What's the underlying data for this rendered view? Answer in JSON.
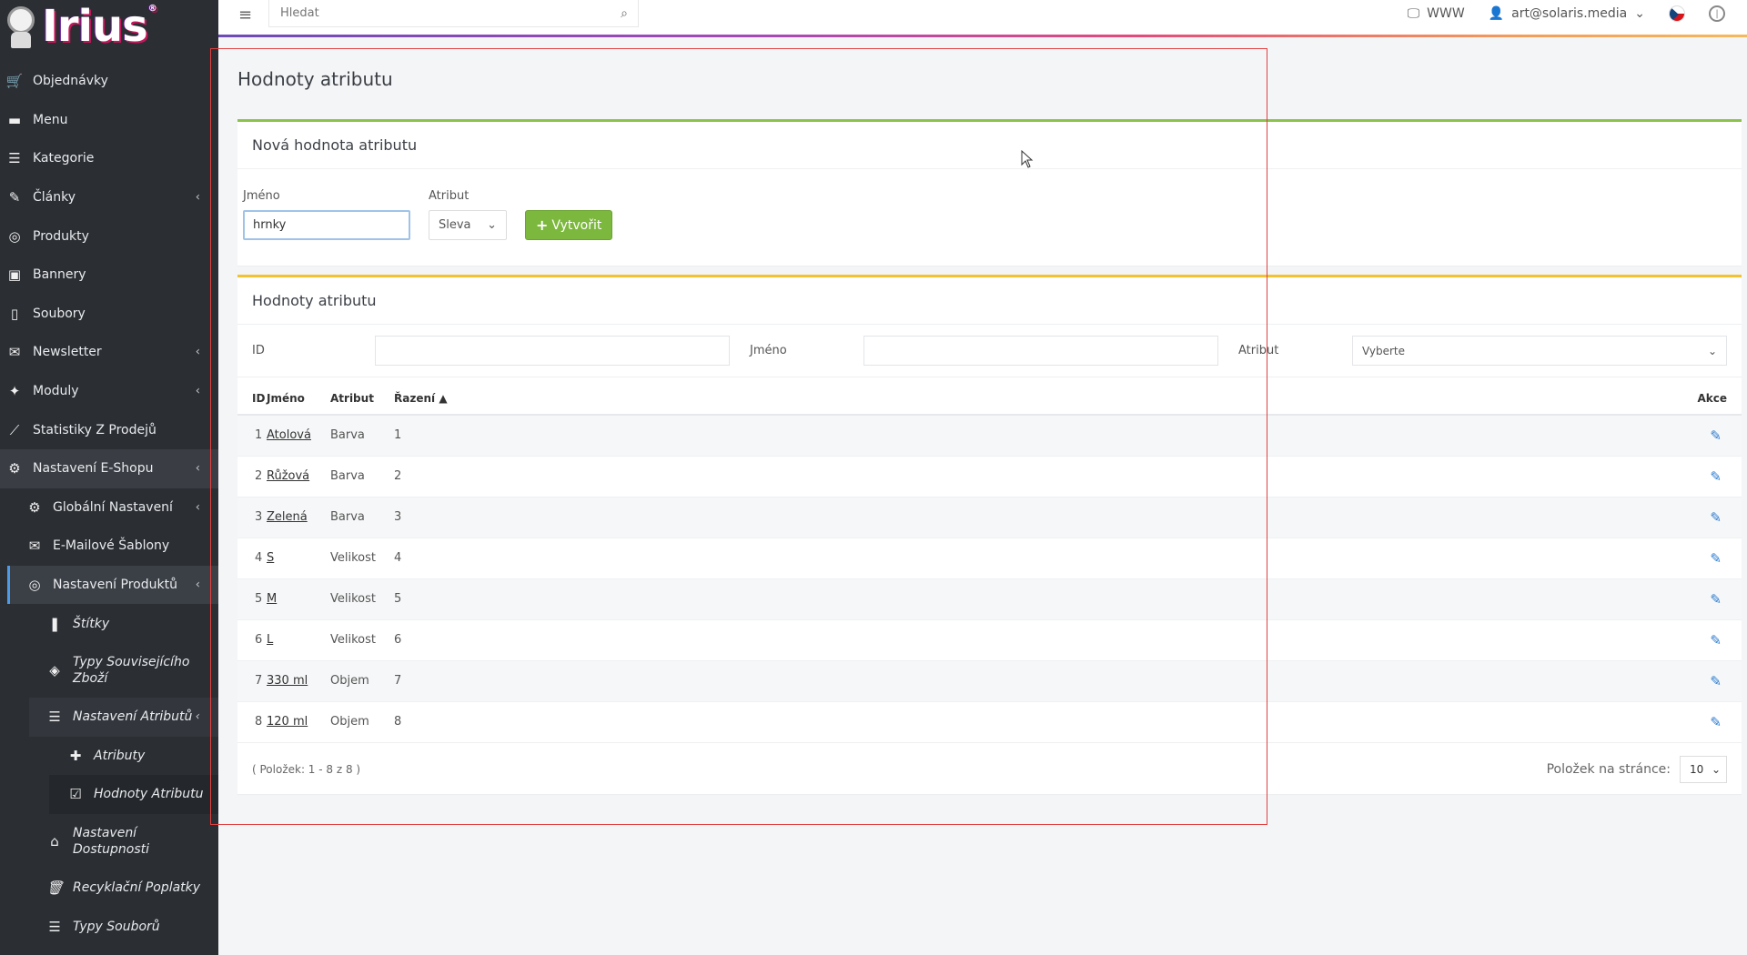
{
  "brand": {
    "logo_text": "Irius",
    "reg": "®"
  },
  "sidebar": {
    "items": [
      {
        "label": "Objednávky",
        "icon": "cart-icon",
        "glyph": "🛒"
      },
      {
        "label": "Menu",
        "icon": "folder-icon",
        "glyph": "▬"
      },
      {
        "label": "Kategorie",
        "icon": "list-icon",
        "glyph": "☰"
      },
      {
        "label": "Články",
        "icon": "pencil-icon",
        "glyph": "✎"
      },
      {
        "label": "Produkty",
        "icon": "globe-icon",
        "glyph": "◎"
      },
      {
        "label": "Bannery",
        "icon": "image-icon",
        "glyph": "▣"
      },
      {
        "label": "Soubory",
        "icon": "file-icon",
        "glyph": "▯"
      },
      {
        "label": "Newsletter",
        "icon": "mail-circle-icon",
        "glyph": "✉"
      },
      {
        "label": "Moduly",
        "icon": "puzzle-icon",
        "glyph": "✦"
      },
      {
        "label": "Statistiky Z Prodejů",
        "icon": "chart-icon",
        "glyph": "⟋"
      },
      {
        "label": "Nastavení E-Shopu",
        "icon": "cogs-icon",
        "glyph": "⚙"
      },
      {
        "label": "Globální Nastavení",
        "icon": "gear-icon",
        "glyph": "⚙"
      },
      {
        "label": "E-Mailové Šablony",
        "icon": "envelope-icon",
        "glyph": "✉"
      },
      {
        "label": "Nastavení Produktů",
        "icon": "globe-icon",
        "glyph": "◎"
      },
      {
        "label": "Štítky",
        "icon": "bookmark-icon",
        "glyph": "❚"
      },
      {
        "label": "Typy Souvisejícího Zboží",
        "icon": "layers-icon",
        "glyph": "◈"
      },
      {
        "label": "Nastavení Atributů",
        "icon": "sliders-icon",
        "glyph": "☰"
      },
      {
        "label": "Atributy",
        "icon": "plus-icon",
        "glyph": "✚"
      },
      {
        "label": "Hodnoty Atributu",
        "icon": "checkbox-icon",
        "glyph": "☑"
      },
      {
        "label": "Nastavení Dostupnosti",
        "icon": "home-icon",
        "glyph": "⌂"
      },
      {
        "label": "Recyklační Poplatky",
        "icon": "trash-icon",
        "glyph": "🗑"
      },
      {
        "label": "Typy Souborů",
        "icon": "list-icon",
        "glyph": "☰"
      }
    ]
  },
  "topbar": {
    "search_placeholder": "Hledat",
    "www_label": "WWW",
    "user_email": "art@solaris.media"
  },
  "page": {
    "title": "Hodnoty atributu"
  },
  "create_form": {
    "heading": "Nová hodnota atributu",
    "name_label": "Jméno",
    "name_value": "hrnky",
    "attr_label": "Atribut",
    "attr_value": "Sleva",
    "button_label": "Vytvořit"
  },
  "list": {
    "heading": "Hodnoty atributu",
    "filter": {
      "id_label": "ID",
      "name_label": "Jméno",
      "attr_label": "Atribut",
      "attr_placeholder": "Vyberte"
    },
    "columns": {
      "id": "ID",
      "name": "Jméno",
      "attr": "Atribut",
      "order": "Řazení",
      "actions": "Akce"
    },
    "rows": [
      {
        "id": "1",
        "name": "Atolová",
        "attr": "Barva",
        "order": "1"
      },
      {
        "id": "2",
        "name": "Růžová",
        "attr": "Barva",
        "order": "2"
      },
      {
        "id": "3",
        "name": "Zelená",
        "attr": "Barva",
        "order": "3"
      },
      {
        "id": "4",
        "name": "S",
        "attr": "Velikost",
        "order": "4"
      },
      {
        "id": "5",
        "name": "M",
        "attr": "Velikost",
        "order": "5"
      },
      {
        "id": "6",
        "name": "L",
        "attr": "Velikost",
        "order": "6"
      },
      {
        "id": "7",
        "name": "330 ml",
        "attr": "Objem",
        "order": "7"
      },
      {
        "id": "8",
        "name": "120 ml",
        "attr": "Objem",
        "order": "8"
      }
    ],
    "summary": "( Položek: 1 - 8 z 8 )",
    "per_page_label": "Položek na stránce:",
    "per_page_value": "10"
  },
  "colors": {
    "sidebar_bg": "#2b2e33",
    "create_accent": "#8bc34a",
    "list_accent": "#f5c12e",
    "edit_icon": "#2b7bd0"
  }
}
